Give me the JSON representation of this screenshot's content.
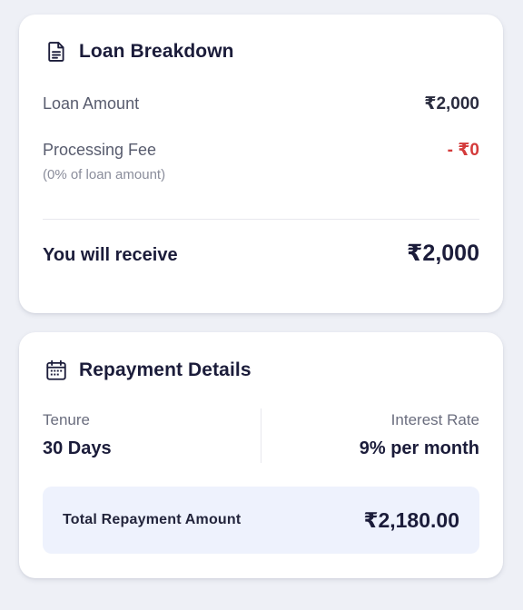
{
  "loan_breakdown": {
    "title": "Loan Breakdown",
    "icon": "document-icon",
    "loan_amount_label": "Loan Amount",
    "loan_amount_value": "₹2,000",
    "processing_fee_label": "Processing Fee",
    "processing_fee_sub": "(0% of loan amount)",
    "processing_fee_value": "- ₹0",
    "receive_label": "You will receive",
    "receive_value": "₹2,000"
  },
  "repayment_details": {
    "title": "Repayment Details",
    "icon": "calendar-icon",
    "tenure_label": "Tenure",
    "tenure_value": "30 Days",
    "interest_label": "Interest Rate",
    "interest_value": "9% per month",
    "total_label": "Total Repayment Amount",
    "total_value": "₹2,180.00"
  },
  "colors": {
    "background": "#eef0f6",
    "card": "#ffffff",
    "text_dark": "#1b1c3a",
    "fee_red": "#d43b3b",
    "total_box": "#eef2fd"
  }
}
